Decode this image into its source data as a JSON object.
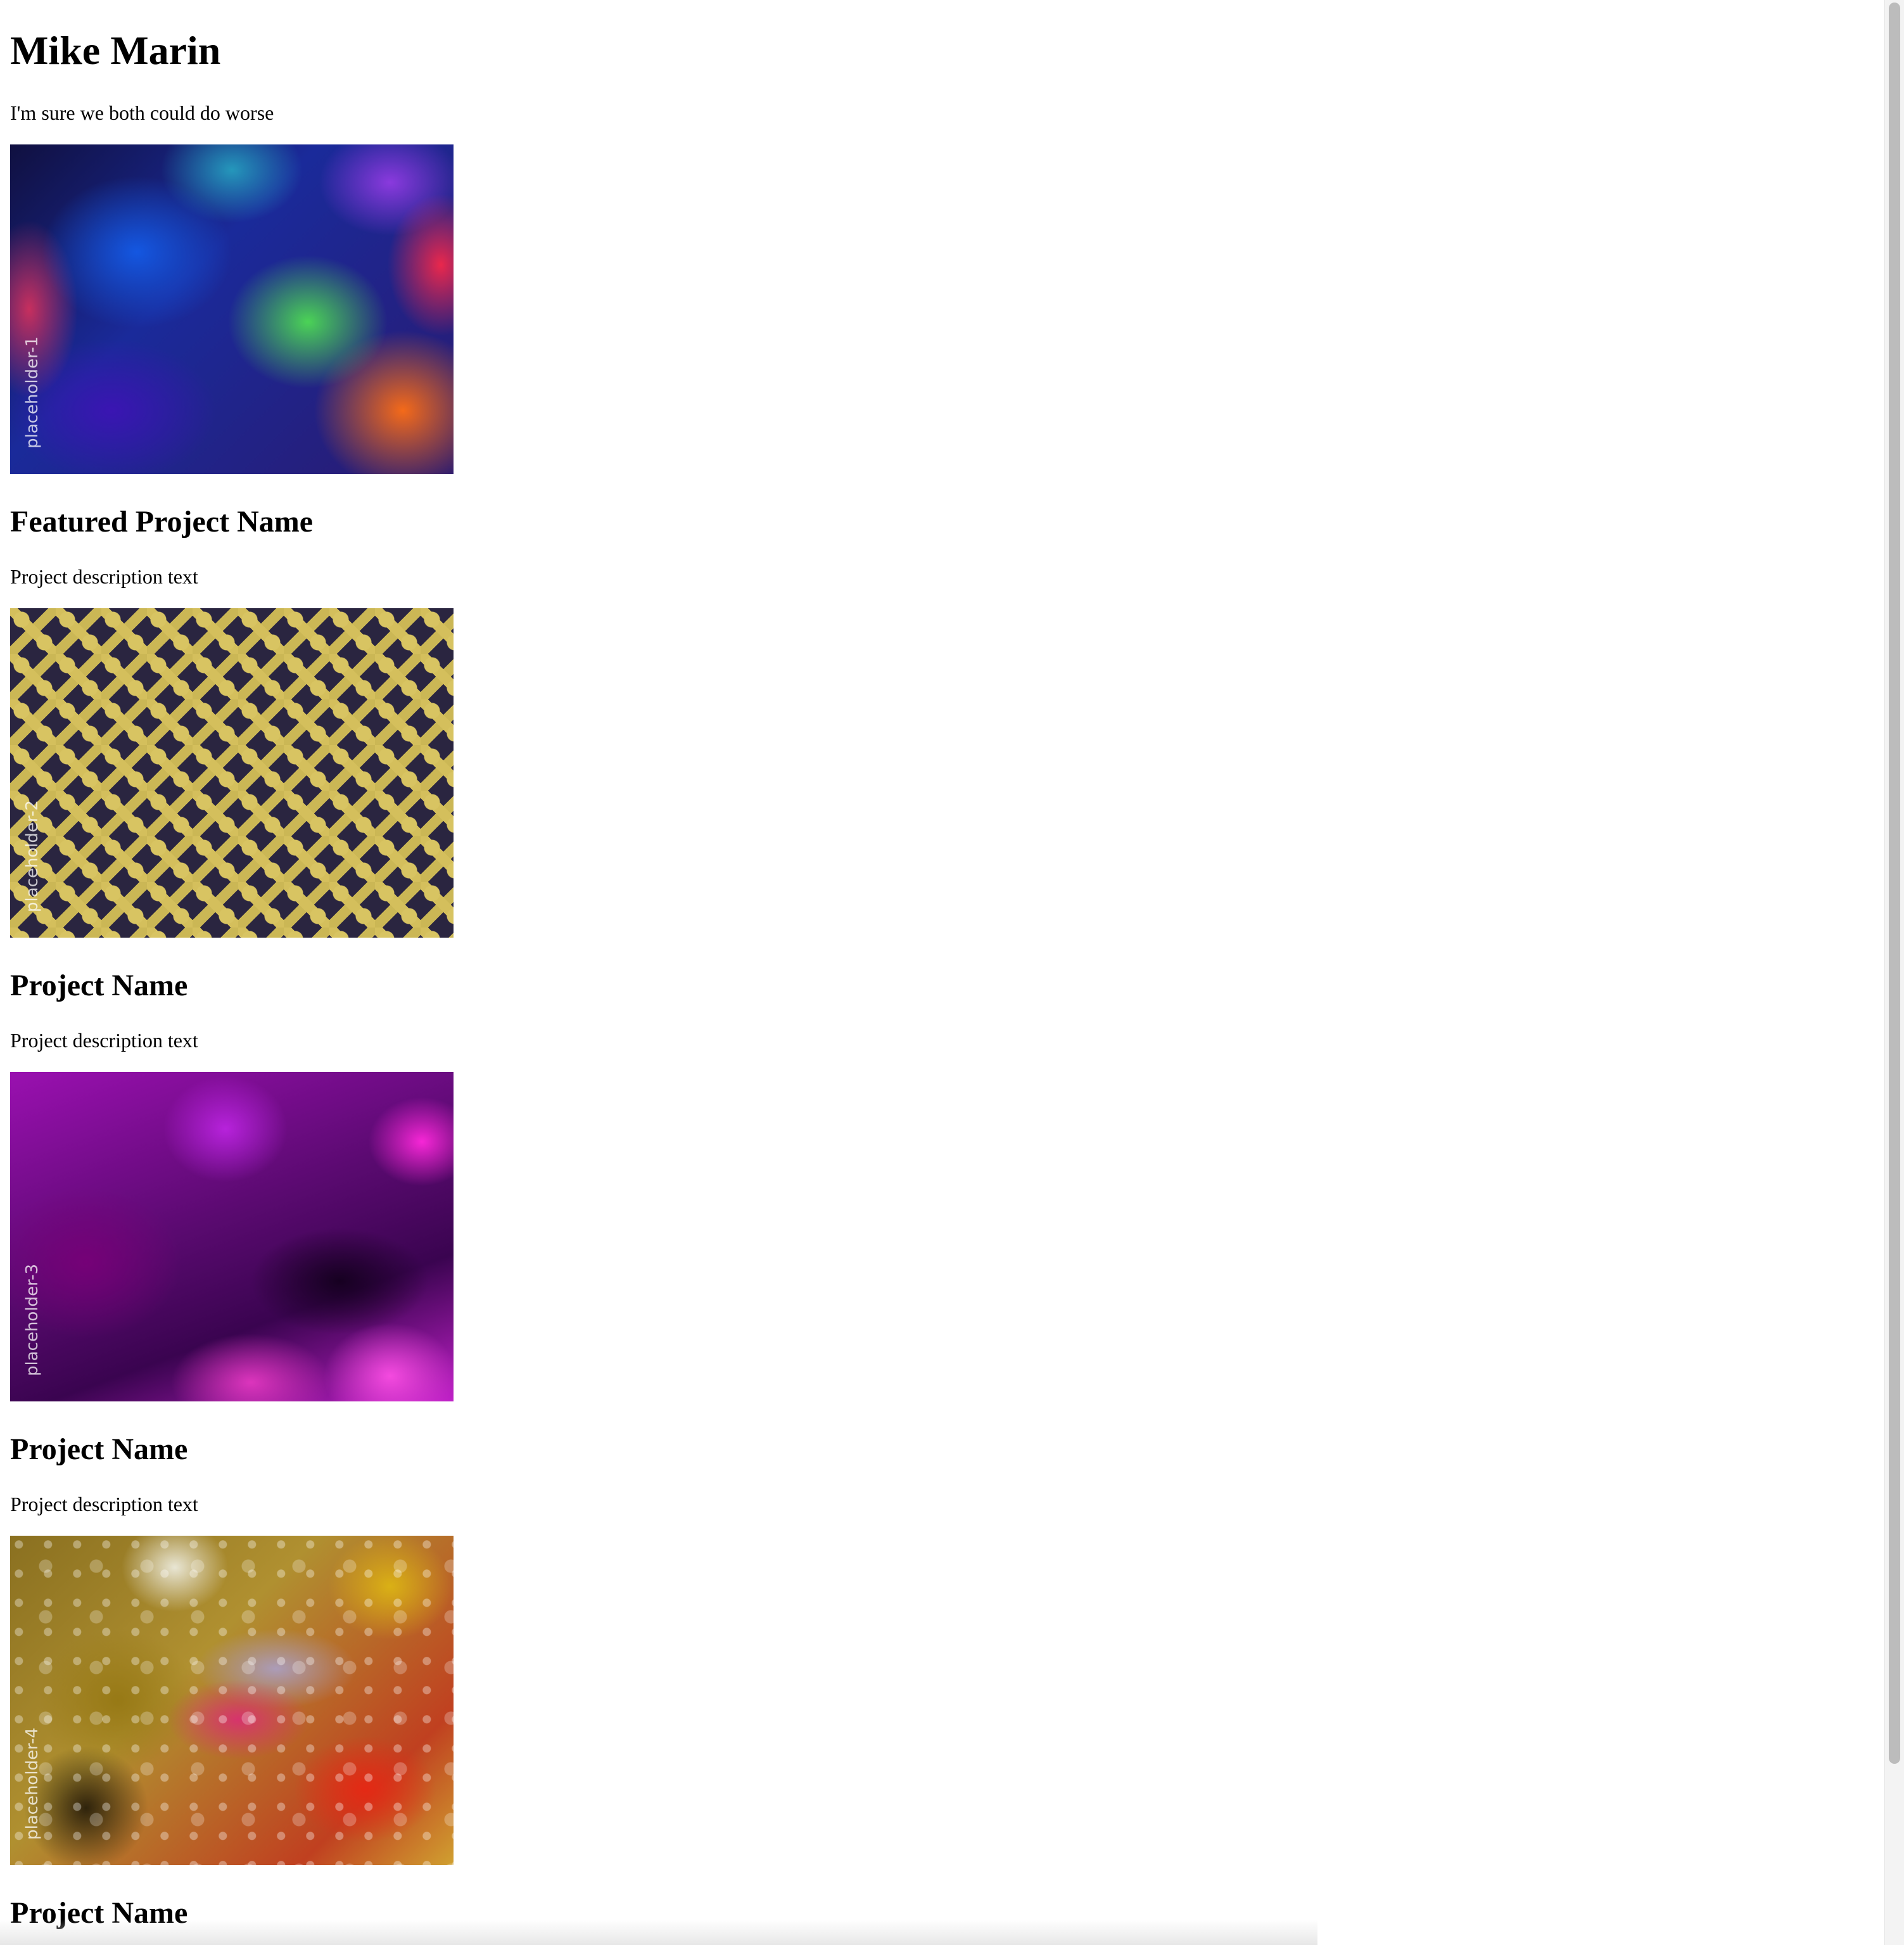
{
  "site": {
    "name": "Mike Marin",
    "tagline": "I'm sure we both could do worse"
  },
  "projects": [
    {
      "image_label": "placeholder-1",
      "title": "Featured Project Name",
      "description": "Project description text"
    },
    {
      "image_label": "placeholder-2",
      "title": "Project Name",
      "description": "Project description text"
    },
    {
      "image_label": "placeholder-3",
      "title": "Project Name",
      "description": "Project description text"
    },
    {
      "image_label": "placeholder-4",
      "title": "Project Name",
      "description": ""
    }
  ]
}
